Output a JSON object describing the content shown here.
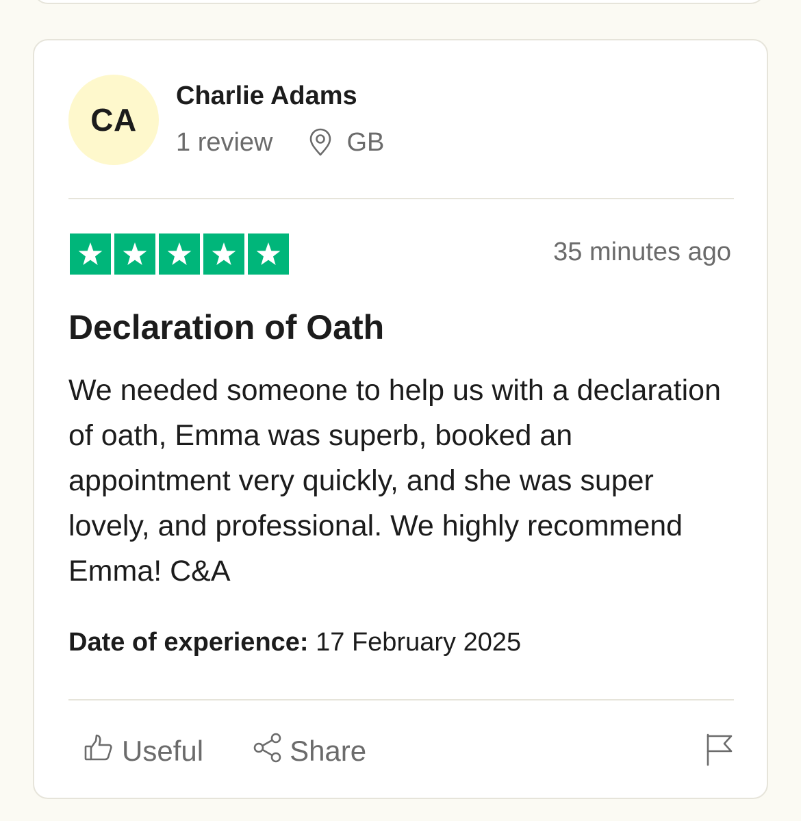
{
  "reviewer": {
    "initials": "CA",
    "name": "Charlie Adams",
    "review_count": "1 review",
    "location": "GB",
    "avatar_color": "#fef8cc"
  },
  "review": {
    "rating": 5,
    "max_rating": 5,
    "star_color": "#00b67a",
    "timestamp": "35 minutes ago",
    "title": "Declaration of Oath",
    "body": "We needed someone to help us with a declaration of oath, Emma was superb, booked an appointment very quickly, and she was super lovely, and professional. We highly recommend Emma! C&A",
    "experience_label": "Date of experience:",
    "experience_date": "17 February 2025"
  },
  "actions": {
    "useful_label": "Useful",
    "share_label": "Share"
  },
  "icons": {
    "location": "location-pin-icon",
    "star": "star-icon",
    "useful": "thumbs-up-icon",
    "share": "share-icon",
    "flag": "flag-icon"
  }
}
